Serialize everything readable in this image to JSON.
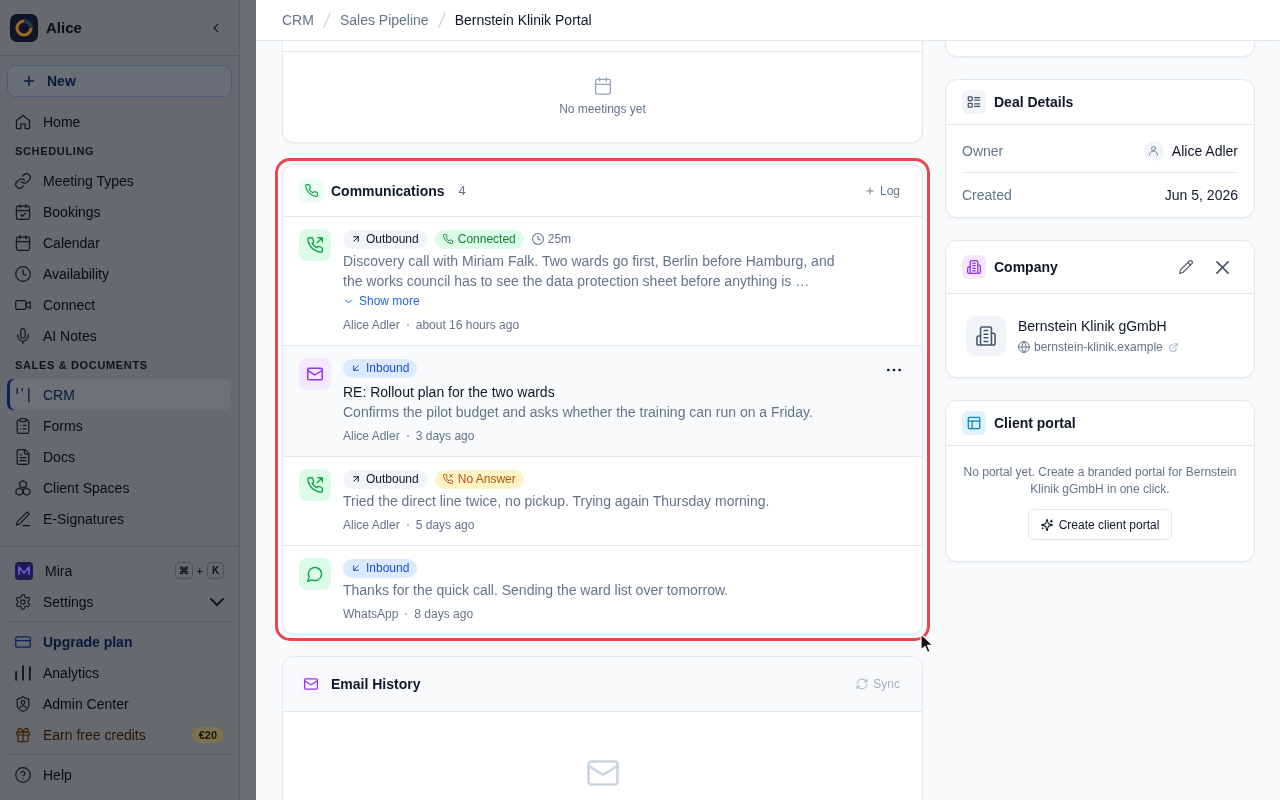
{
  "sidebar": {
    "workspace": "Alice",
    "new_button": "New",
    "nav": [
      {
        "kind": "link",
        "label": "Home",
        "selected": false
      },
      {
        "kind": "heading",
        "label": "SCHEDULING"
      },
      {
        "kind": "link",
        "label": "Meeting Types",
        "selected": false
      },
      {
        "kind": "link",
        "label": "Bookings",
        "selected": false
      },
      {
        "kind": "link",
        "label": "Calendar",
        "selected": false
      },
      {
        "kind": "link",
        "label": "Availability",
        "selected": false
      },
      {
        "kind": "link",
        "label": "Connect",
        "selected": false
      },
      {
        "kind": "link",
        "label": "AI Notes",
        "selected": false
      },
      {
        "kind": "heading",
        "label": "SALES & DOCUMENTS"
      },
      {
        "kind": "link",
        "label": "CRM",
        "selected": true
      },
      {
        "kind": "link",
        "label": "Forms",
        "selected": false
      },
      {
        "kind": "link",
        "label": "Docs",
        "selected": false
      },
      {
        "kind": "link",
        "label": "Client Spaces",
        "selected": false
      },
      {
        "kind": "link",
        "label": "E-Signatures",
        "selected": false
      }
    ],
    "footer": [
      {
        "items": [
          {
            "kind": "assistant",
            "label": "Mira",
            "shortcut": {
              "keys": [
                "⌘",
                "K"
              ],
              "joiner": "+"
            }
          },
          {
            "kind": "expander",
            "label": "Settings",
            "expanded": false
          }
        ]
      },
      {
        "items": [
          {
            "kind": "upgrade",
            "label": "Upgrade plan"
          },
          {
            "kind": "link",
            "label": "Analytics"
          },
          {
            "kind": "link",
            "label": "Admin Center"
          },
          {
            "kind": "reward",
            "label": "Earn free credits",
            "badge": "€20"
          }
        ]
      },
      {
        "items": [
          {
            "kind": "link",
            "label": "Help"
          }
        ]
      }
    ]
  },
  "header": {
    "breadcrumb": [
      {
        "label": "CRM",
        "current": false
      },
      {
        "label": "Sales Pipeline",
        "current": false
      },
      {
        "label": "Bernstein Klinik Portal",
        "current": true
      }
    ]
  },
  "meetings": {
    "empty_text": "No meetings yet"
  },
  "communications": {
    "title": "Communications",
    "count": "4",
    "highlighted": true,
    "log_button": "Log",
    "items": [
      {
        "kind": "call",
        "hovered": false,
        "direction": {
          "kind": "outbound",
          "label": "Outbound"
        },
        "status": {
          "kind": "connected",
          "label": "Connected"
        },
        "duration": "25m",
        "text": "Discovery call with Miriam Falk. Two wards go first, Berlin before Hamburg, and the works council has to see the data protection sheet before anything is …",
        "show_more": "Show more",
        "byline": "Alice Adler",
        "time": "about 16 hours ago"
      },
      {
        "kind": "email",
        "hovered": true,
        "direction": {
          "kind": "inbound",
          "label": "Inbound"
        },
        "subject": "RE: Rollout plan for the two wards",
        "text": "Confirms the pilot budget and asks whether the training can run on a Friday.",
        "byline": "Alice Adler",
        "time": "3 days ago"
      },
      {
        "kind": "call",
        "hovered": false,
        "direction": {
          "kind": "outbound",
          "label": "Outbound"
        },
        "status": {
          "kind": "no_answer",
          "label": "No Answer"
        },
        "text": "Tried the direct line twice, no pickup. Trying again Thursday morning.",
        "byline": "Alice Adler",
        "time": "5 days ago"
      },
      {
        "kind": "chat",
        "hovered": false,
        "direction": {
          "kind": "inbound",
          "label": "Inbound"
        },
        "text": "Thanks for the quick call. Sending the ward list over tomorrow.",
        "byline": "WhatsApp",
        "time": "8 days ago"
      }
    ]
  },
  "email_history": {
    "title": "Email History",
    "sync_button": {
      "label": "Sync",
      "disabled": true
    }
  },
  "deal_details": {
    "title": "Deal Details",
    "fields": [
      {
        "kind": "person",
        "label": "Owner",
        "value": "Alice Adler"
      },
      {
        "kind": "text",
        "label": "Created",
        "value": "Jun 5, 2026"
      }
    ]
  },
  "company": {
    "title": "Company",
    "name": "Bernstein Klinik gGmbH",
    "website": "bernstein-klinik.example"
  },
  "client_portal": {
    "title": "Client portal",
    "message": "No portal yet. Create a branded portal for Bernstein Klinik gGmbH in one click.",
    "button": "Create client portal"
  }
}
